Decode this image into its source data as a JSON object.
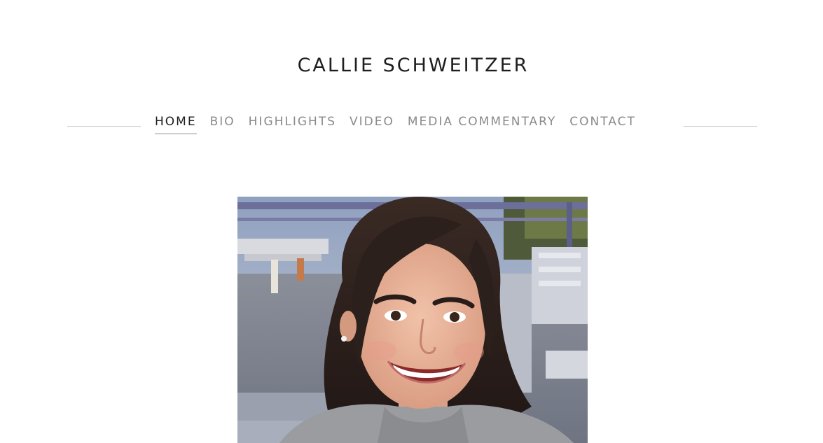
{
  "site": {
    "title": "CALLIE SCHWEITZER"
  },
  "nav": {
    "items": [
      {
        "label": "HOME",
        "active": true
      },
      {
        "label": "BIO",
        "active": false
      },
      {
        "label": "HIGHLIGHTS",
        "active": false
      },
      {
        "label": "VIDEO",
        "active": false
      },
      {
        "label": "MEDIA COMMENTARY",
        "active": false
      },
      {
        "label": "CONTACT",
        "active": false
      }
    ]
  },
  "colors": {
    "text_dark": "#1e1e1e",
    "nav_inactive": "#8a8a8a",
    "rule": "#cfcfcf",
    "background": "#ffffff"
  },
  "hero": {
    "image": "portrait-photo"
  }
}
